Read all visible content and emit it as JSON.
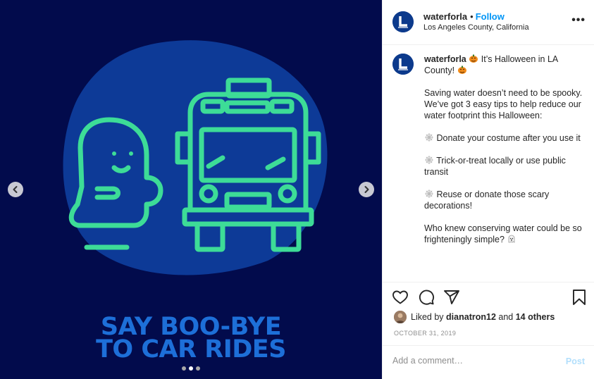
{
  "media": {
    "slogan_line1": "SAY BOO-BYE",
    "slogan_line2": "TO CAR RIDES",
    "carousel": {
      "total": 3,
      "active": 2
    },
    "colors": {
      "background": "#020b4c",
      "blob": "#0d3a97",
      "lineart": "#3ddc97",
      "slogan": "#1d6fd8"
    },
    "icons": {
      "prev": "chevron-left-icon",
      "next": "chevron-right-icon",
      "ghost": "ghost-icon",
      "bus": "bus-icon"
    }
  },
  "header": {
    "username": "waterforla",
    "separator": "•",
    "follow_label": "Follow",
    "location": "Los Angeles County, California",
    "more_label": "•••"
  },
  "caption": {
    "username": "waterforla",
    "line1": "It’s Halloween in LA County!",
    "para1": "Saving water doesn’t need to be spooky. We’ve got 3 easy tips to help reduce our water footprint this Halloween:",
    "tip1": "Donate your costume after you use it",
    "tip2": "Trick-or-treat locally or use public transit",
    "tip3": "Reuse or donate those scary decorations!",
    "closing": "Who knew conserving water could be so frighteningly simple?"
  },
  "actions": {
    "liked_by_prefix": "Liked by",
    "liked_by_user": "dianatron12",
    "and_label": "and",
    "others_label": "14 others",
    "date": "October 31, 2019",
    "icons": [
      "heart-icon",
      "comment-icon",
      "share-icon",
      "bookmark-icon"
    ]
  },
  "comment": {
    "placeholder": "Add a comment…",
    "post_label": "Post"
  },
  "colors": {
    "accent": "#0095f6",
    "post_disabled": "#b2dffc",
    "muted": "#8e8e8e"
  }
}
